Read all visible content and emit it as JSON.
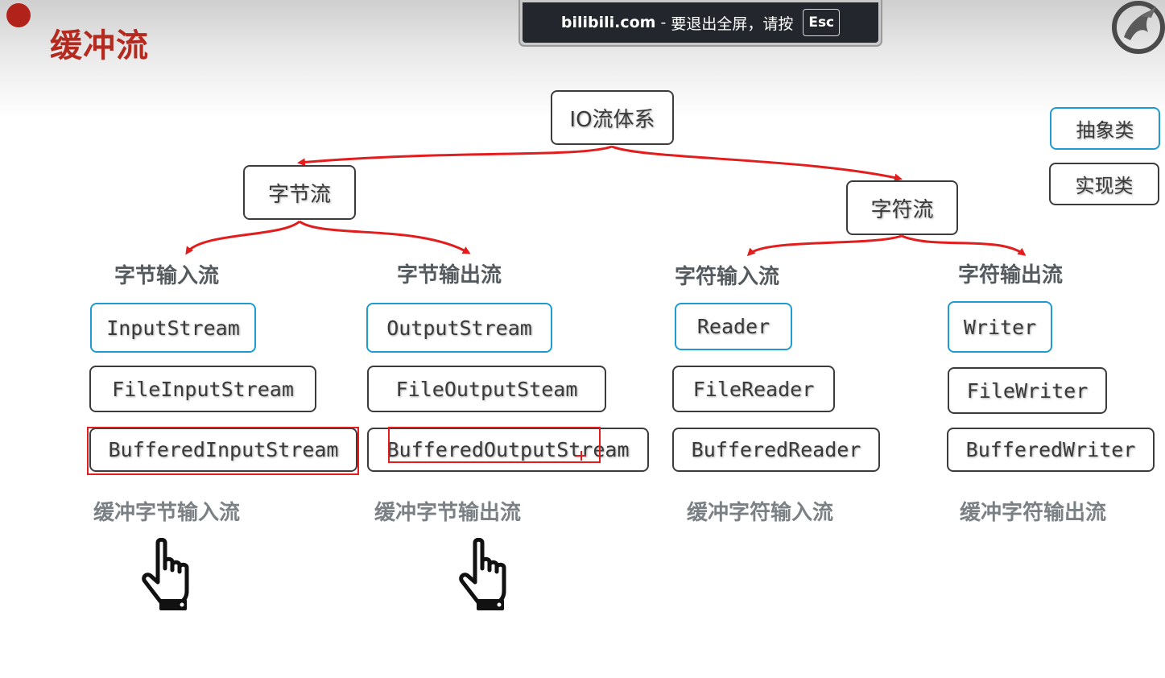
{
  "slide": {
    "title": "缓冲流"
  },
  "fullscreen_banner": {
    "host": "bilibili.com",
    "separator": "-",
    "message": "要退出全屏，请按",
    "key": "Esc"
  },
  "legend": {
    "abstract_label": "抽象类",
    "impl_label": "实现类"
  },
  "tree": {
    "root": "IO流体系",
    "byte_stream": "字节流",
    "char_stream": "字符流"
  },
  "columns": [
    {
      "heading": "字节输入流",
      "abstract": "InputStream",
      "impl": "FileInputStream",
      "buffered": "BufferedInputStream",
      "caption": "缓冲字节输入流"
    },
    {
      "heading": "字节输出流",
      "abstract": "OutputStream",
      "impl": "FileOutputSteam",
      "buffered": "BufferedOutputStream",
      "caption": "缓冲字节输出流"
    },
    {
      "heading": "字符输入流",
      "abstract": "Reader",
      "impl": "FileReader",
      "buffered": "BufferedReader",
      "caption": "缓冲字符输入流"
    },
    {
      "heading": "字符输出流",
      "abstract": "Writer",
      "impl": "FileWriter",
      "buffered": "BufferedWriter",
      "caption": "缓冲字符输出流"
    }
  ],
  "colors": {
    "title": "#b42a1f",
    "arrow": "#e31d1d",
    "abstract_border": "#1e9bd0",
    "impl_border": "#3c3c3c",
    "highlight": "#e31d1d"
  },
  "icons": [
    "pointing-hand-icon",
    "logo-icon"
  ]
}
